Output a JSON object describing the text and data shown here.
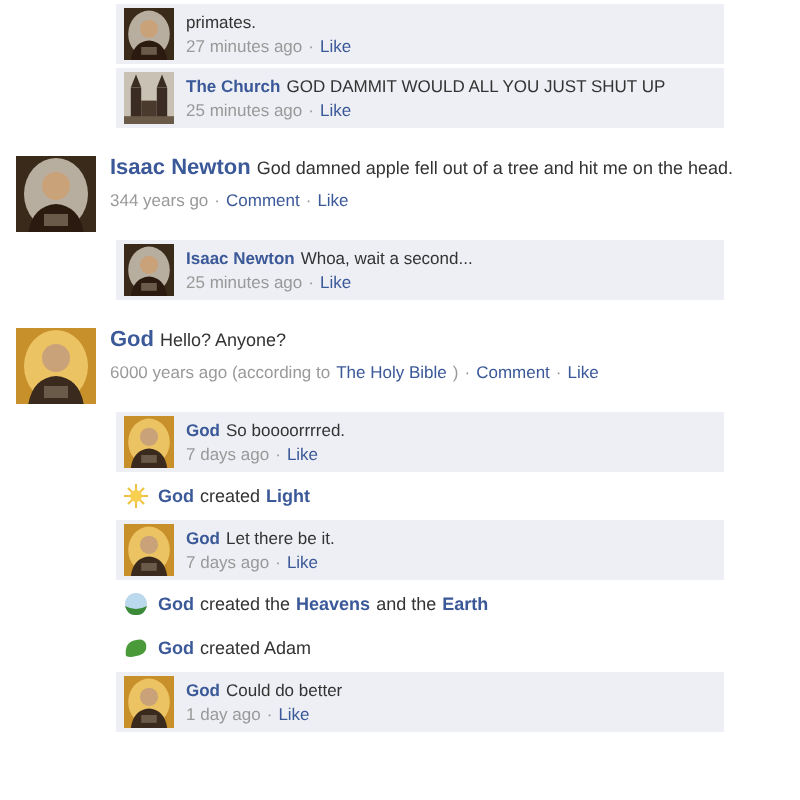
{
  "feed": [
    {
      "kind": "comment",
      "text": [
        {
          "text": "primates.",
          "link": false
        }
      ],
      "meta": [
        {
          "text": "27 minutes ago",
          "link": false
        },
        {
          "text": "·",
          "link": false
        },
        {
          "text": "Like",
          "link": true
        }
      ]
    },
    {
      "kind": "comment",
      "text": [
        {
          "text": "The Church",
          "link": true
        },
        {
          "text": "GOD DAMMIT WOULD ALL YOU JUST SHUT UP",
          "link": false
        }
      ],
      "meta": [
        {
          "text": "25 minutes ago",
          "link": false
        },
        {
          "text": "·",
          "link": false
        },
        {
          "text": "Like",
          "link": true
        }
      ]
    },
    {
      "kind": "post",
      "text": [
        {
          "text": "Isaac Newton",
          "link": true
        },
        {
          "text": "God damned apple fell out of a tree and hit me on the head.",
          "link": false
        }
      ],
      "meta": [
        {
          "text": "344 years go",
          "link": false
        },
        {
          "text": "·",
          "link": false
        },
        {
          "text": "Comment",
          "link": true
        },
        {
          "text": "·",
          "link": false
        },
        {
          "text": "Like",
          "link": true
        }
      ]
    },
    {
      "kind": "comment",
      "text": [
        {
          "text": "Isaac Newton",
          "link": true
        },
        {
          "text": "Whoa, wait a second...",
          "link": false
        }
      ],
      "meta": [
        {
          "text": "25 minutes ago",
          "link": false
        },
        {
          "text": "·",
          "link": false
        },
        {
          "text": "Like",
          "link": true
        }
      ]
    },
    {
      "kind": "post",
      "text": [
        {
          "text": "God",
          "link": true
        },
        {
          "text": "Hello?  Anyone?",
          "link": false
        }
      ],
      "meta": [
        {
          "text": "6000 years ago (according to",
          "link": false
        },
        {
          "text": "The Holy Bible",
          "link": true
        },
        {
          "text": ")",
          "link": false
        },
        {
          "text": "·",
          "link": false
        },
        {
          "text": "Comment",
          "link": true
        },
        {
          "text": "·",
          "link": false
        },
        {
          "text": "Like",
          "link": true
        }
      ]
    },
    {
      "kind": "comment",
      "text": [
        {
          "text": "God",
          "link": true
        },
        {
          "text": "So boooorrrred.",
          "link": false
        }
      ],
      "meta": [
        {
          "text": "7 days ago",
          "link": false
        },
        {
          "text": "·",
          "link": false
        },
        {
          "text": "Like",
          "link": true
        }
      ]
    },
    {
      "kind": "story",
      "text": [
        {
          "text": "God",
          "link": true
        },
        {
          "text": "created",
          "link": false
        },
        {
          "text": "Light",
          "link": true
        }
      ]
    },
    {
      "kind": "comment",
      "text": [
        {
          "text": "God",
          "link": true
        },
        {
          "text": "Let there be it.",
          "link": false
        }
      ],
      "meta": [
        {
          "text": "7 days ago",
          "link": false
        },
        {
          "text": "·",
          "link": false
        },
        {
          "text": "Like",
          "link": true
        }
      ]
    },
    {
      "kind": "story",
      "text": [
        {
          "text": "God",
          "link": true
        },
        {
          "text": "created the",
          "link": false
        },
        {
          "text": "Heavens",
          "link": true
        },
        {
          "text": "and the",
          "link": false
        },
        {
          "text": "Earth",
          "link": true
        }
      ]
    },
    {
      "kind": "story",
      "text": [
        {
          "text": "God",
          "link": true
        },
        {
          "text": "created Adam",
          "link": false
        }
      ]
    },
    {
      "kind": "comment",
      "text": [
        {
          "text": "God",
          "link": true
        },
        {
          "text": "Could do better",
          "link": false
        }
      ],
      "meta": [
        {
          "text": "1 day ago",
          "link": false
        },
        {
          "text": "·",
          "link": false
        },
        {
          "text": "Like",
          "link": true
        }
      ]
    }
  ]
}
